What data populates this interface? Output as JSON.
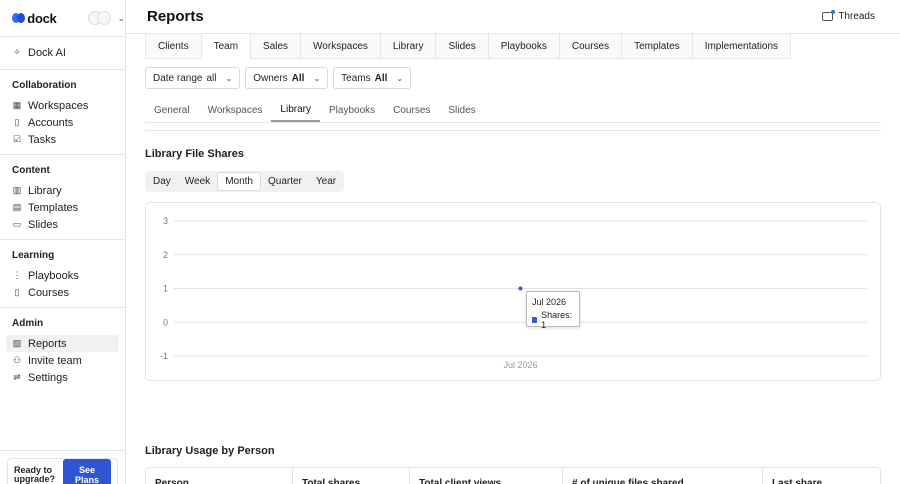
{
  "brand": {
    "name": "dock"
  },
  "sidebar": {
    "dock_ai": "Dock AI",
    "sections": [
      {
        "title": "Collaboration",
        "items": [
          "Workspaces",
          "Accounts",
          "Tasks"
        ]
      },
      {
        "title": "Content",
        "items": [
          "Library",
          "Templates",
          "Slides"
        ]
      },
      {
        "title": "Learning",
        "items": [
          "Playbooks",
          "Courses"
        ]
      },
      {
        "title": "Admin",
        "items": [
          "Reports",
          "Invite team",
          "Settings"
        ]
      }
    ],
    "upgrade_text_1": "Ready to",
    "upgrade_text_2": "upgrade?",
    "upgrade_button": "See Plans"
  },
  "header": {
    "title": "Reports",
    "threads": "Threads"
  },
  "top_tabs": [
    "Clients",
    "Team",
    "Sales",
    "Workspaces",
    "Library",
    "Slides",
    "Playbooks",
    "Courses",
    "Templates",
    "Implementations"
  ],
  "top_tab_active": "Team",
  "filters": {
    "date_range_label": "Date range",
    "date_range_value": "all",
    "owners_label": "Owners",
    "owners_value": "All",
    "teams_label": "Teams",
    "teams_value": "All"
  },
  "sub_tabs": [
    "General",
    "Workspaces",
    "Library",
    "Playbooks",
    "Courses",
    "Slides"
  ],
  "sub_tab_active": "Library",
  "file_shares": {
    "title": "Library File Shares",
    "periods": [
      "Day",
      "Week",
      "Month",
      "Quarter",
      "Year"
    ],
    "period_active": "Month"
  },
  "chart_data": {
    "type": "line",
    "x": [
      "Jul 2026"
    ],
    "series": [
      {
        "name": "Shares",
        "values": [
          1
        ]
      }
    ],
    "y_ticks": [
      3,
      2,
      1,
      0,
      -1
    ],
    "x_ticks": [
      "Jul 2026"
    ],
    "ylim": [
      -1,
      3
    ],
    "grid": true,
    "tooltip": {
      "title": "Jul 2026",
      "label": "Shares: 1"
    },
    "color": "#3b55d9"
  },
  "usage": {
    "title": "Library Usage by Person",
    "columns": [
      "Person",
      "Total shares",
      "Total client views",
      "# of unique files shared",
      "Last share"
    ]
  }
}
